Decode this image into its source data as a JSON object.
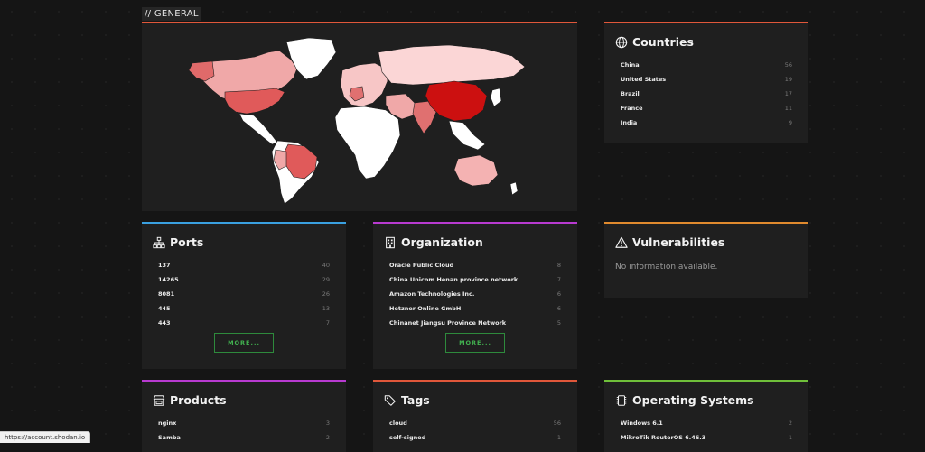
{
  "section": {
    "title": "// GENERAL"
  },
  "colors": {
    "map_header": "#e0573a",
    "countries_header": "#e0573a",
    "ports_header": "#3aa0e0",
    "organization_header": "#b83ad0",
    "vulnerabilities_header": "#e08a2e",
    "products_header": "#b83ad0",
    "tags_header": "#e0573a",
    "os_header": "#6fbf3a",
    "more_button": "#42b350"
  },
  "countries": {
    "title": "Countries",
    "icon": "globe-icon",
    "items": [
      {
        "name": "China",
        "count": "56"
      },
      {
        "name": "United States",
        "count": "19"
      },
      {
        "name": "Brazil",
        "count": "17"
      },
      {
        "name": "France",
        "count": "11"
      },
      {
        "name": "India",
        "count": "9"
      }
    ]
  },
  "ports": {
    "title": "Ports",
    "icon": "sitemap-icon",
    "more": "MORE...",
    "items": [
      {
        "name": "137",
        "count": "40"
      },
      {
        "name": "14265",
        "count": "29"
      },
      {
        "name": "8081",
        "count": "26"
      },
      {
        "name": "445",
        "count": "13"
      },
      {
        "name": "443",
        "count": "7"
      }
    ]
  },
  "organization": {
    "title": "Organization",
    "icon": "building-icon",
    "more": "MORE...",
    "items": [
      {
        "name": "Oracle Public Cloud",
        "count": "8"
      },
      {
        "name": "China Unicom Henan province network",
        "count": "7"
      },
      {
        "name": "Amazon Technologies Inc.",
        "count": "6"
      },
      {
        "name": "Hetzner Online GmbH",
        "count": "6"
      },
      {
        "name": "Chinanet Jiangsu Province Network",
        "count": "5"
      }
    ]
  },
  "vulnerabilities": {
    "title": "Vulnerabilities",
    "icon": "warning-icon",
    "message": "No information available."
  },
  "products": {
    "title": "Products",
    "icon": "store-icon",
    "items": [
      {
        "name": "nginx",
        "count": "3"
      },
      {
        "name": "Samba",
        "count": "2"
      }
    ]
  },
  "tags": {
    "title": "Tags",
    "icon": "tags-icon",
    "items": [
      {
        "name": "cloud",
        "count": "56"
      },
      {
        "name": "self-signed",
        "count": "1"
      }
    ]
  },
  "os": {
    "title": "Operating Systems",
    "icon": "chip-icon",
    "items": [
      {
        "name": "Windows 6.1",
        "count": "2"
      },
      {
        "name": "MikroTik RouterOS 6.46.3",
        "count": "1"
      }
    ]
  },
  "status_bar": {
    "url": "https://account.shodan.io"
  }
}
